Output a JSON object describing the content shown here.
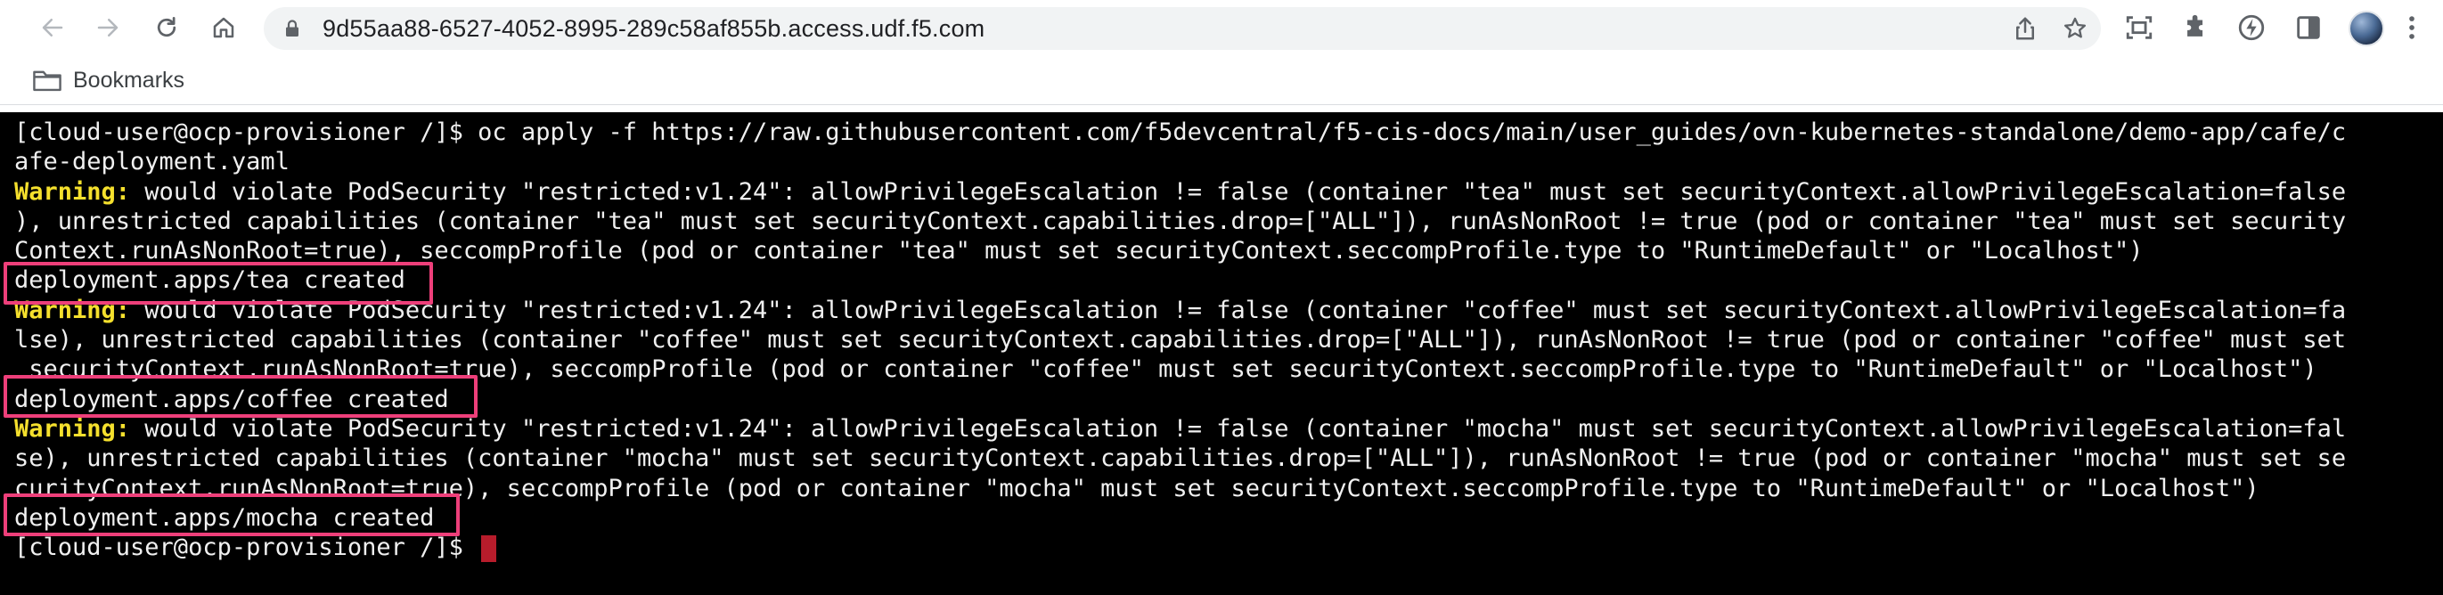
{
  "browser": {
    "url": "9d55aa88-6527-4052-8995-289c58af855b.access.udf.f5.com",
    "colors": {
      "toolbar": "#ffffff",
      "omnibox": "#f1f3f4",
      "terminal_bg": "#000000",
      "terminal_text": "#f0f0f0",
      "warning": "#f5e02d",
      "highlight_box": "#ee3f7a",
      "cursor": "#b71c2b"
    },
    "nav_icons": [
      "back-arrow-icon",
      "forward-arrow-icon",
      "reload-icon",
      "home-icon"
    ],
    "omnibox_icons": [
      "share-icon",
      "star-icon"
    ],
    "toolbar_icons": [
      "screen-capture-icon",
      "puzzle-extension-icon",
      "lightning-extension-icon",
      "side-panel-icon"
    ]
  },
  "bookmarks": {
    "folder_label": "Bookmarks"
  },
  "terminal": {
    "lines": [
      {
        "text": "[cloud-user@ocp-provisioner /]$ oc apply -f https://raw.githubusercontent.com/f5devcentral/f5-cis-docs/main/user_guides/ovn-kubernetes-standalone/demo-app/cafe/c"
      },
      {
        "text": "afe-deployment.yaml"
      },
      {
        "label": "Warning:",
        "text": " would violate PodSecurity \"restricted:v1.24\": allowPrivilegeEscalation != false (container \"tea\" must set securityContext.allowPrivilegeEscalation=false"
      },
      {
        "text": "), unrestricted capabilities (container \"tea\" must set securityContext.capabilities.drop=[\"ALL\"]), runAsNonRoot != true (pod or container \"tea\" must set security"
      },
      {
        "text": "Context.runAsNonRoot=true), seccompProfile (pod or container \"tea\" must set securityContext.seccompProfile.type to \"RuntimeDefault\" or \"Localhost\")"
      },
      {
        "text": "deployment.apps/tea created"
      },
      {
        "label": "Warning:",
        "text": " would violate PodSecurity \"restricted:v1.24\": allowPrivilegeEscalation != false (container \"coffee\" must set securityContext.allowPrivilegeEscalation=fa"
      },
      {
        "text": "lse), unrestricted capabilities (container \"coffee\" must set securityContext.capabilities.drop=[\"ALL\"]), runAsNonRoot != true (pod or container \"coffee\" must set"
      },
      {
        "text": " securityContext.runAsNonRoot=true), seccompProfile (pod or container \"coffee\" must set securityContext.seccompProfile.type to \"RuntimeDefault\" or \"Localhost\")"
      },
      {
        "text": "deployment.apps/coffee created"
      },
      {
        "label": "Warning:",
        "text": " would violate PodSecurity \"restricted:v1.24\": allowPrivilegeEscalation != false (container \"mocha\" must set securityContext.allowPrivilegeEscalation=fal"
      },
      {
        "text": "se), unrestricted capabilities (container \"mocha\" must set securityContext.capabilities.drop=[\"ALL\"]), runAsNonRoot != true (pod or container \"mocha\" must set se"
      },
      {
        "text": "curityContext.runAsNonRoot=true), seccompProfile (pod or container \"mocha\" must set securityContext.seccompProfile.type to \"RuntimeDefault\" or \"Localhost\")"
      },
      {
        "text": "deployment.apps/mocha created"
      },
      {
        "text": "[cloud-user@ocp-provisioner /]$ "
      }
    ]
  }
}
